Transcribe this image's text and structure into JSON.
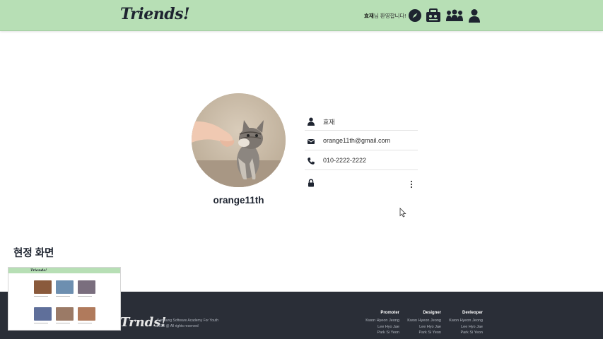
{
  "header": {
    "logo": "Triends!",
    "welcome_name": "효재",
    "welcome_suffix": "님 환영합니다!",
    "icons": [
      "compass-icon",
      "map-board-icon",
      "group-icon",
      "user-icon"
    ]
  },
  "profile": {
    "username": "orange11th",
    "name": "효재",
    "email": "orange11th@gmail.com",
    "phone": "010-2222-2222",
    "password": ""
  },
  "section": {
    "title": "현정 화면"
  },
  "thumbnail": {
    "logo": "Triends!"
  },
  "footer": {
    "logo": "Trnds!",
    "org": "Samsung Software Academy For Youth",
    "copyright": "2023 @ All rights reserved",
    "columns": [
      {
        "title": "Promoter",
        "names": [
          "Kwon Hyeon Jeong",
          "Lee Hyo Jae",
          "Park Si Yeon"
        ]
      },
      {
        "title": "Designer",
        "names": [
          "Kwon Hyeon Jeong",
          "Lee Hyo Jae",
          "Park Si Yeon"
        ]
      },
      {
        "title": "Devleoper",
        "names": [
          "Kwon Hyeon Jeong",
          "Lee Hyo Jae",
          "Park Si Yeon"
        ]
      }
    ]
  },
  "colors": {
    "header_bg": "#b7dfb5",
    "footer_bg": "#2a2e37",
    "text_dark": "#1e2430"
  }
}
